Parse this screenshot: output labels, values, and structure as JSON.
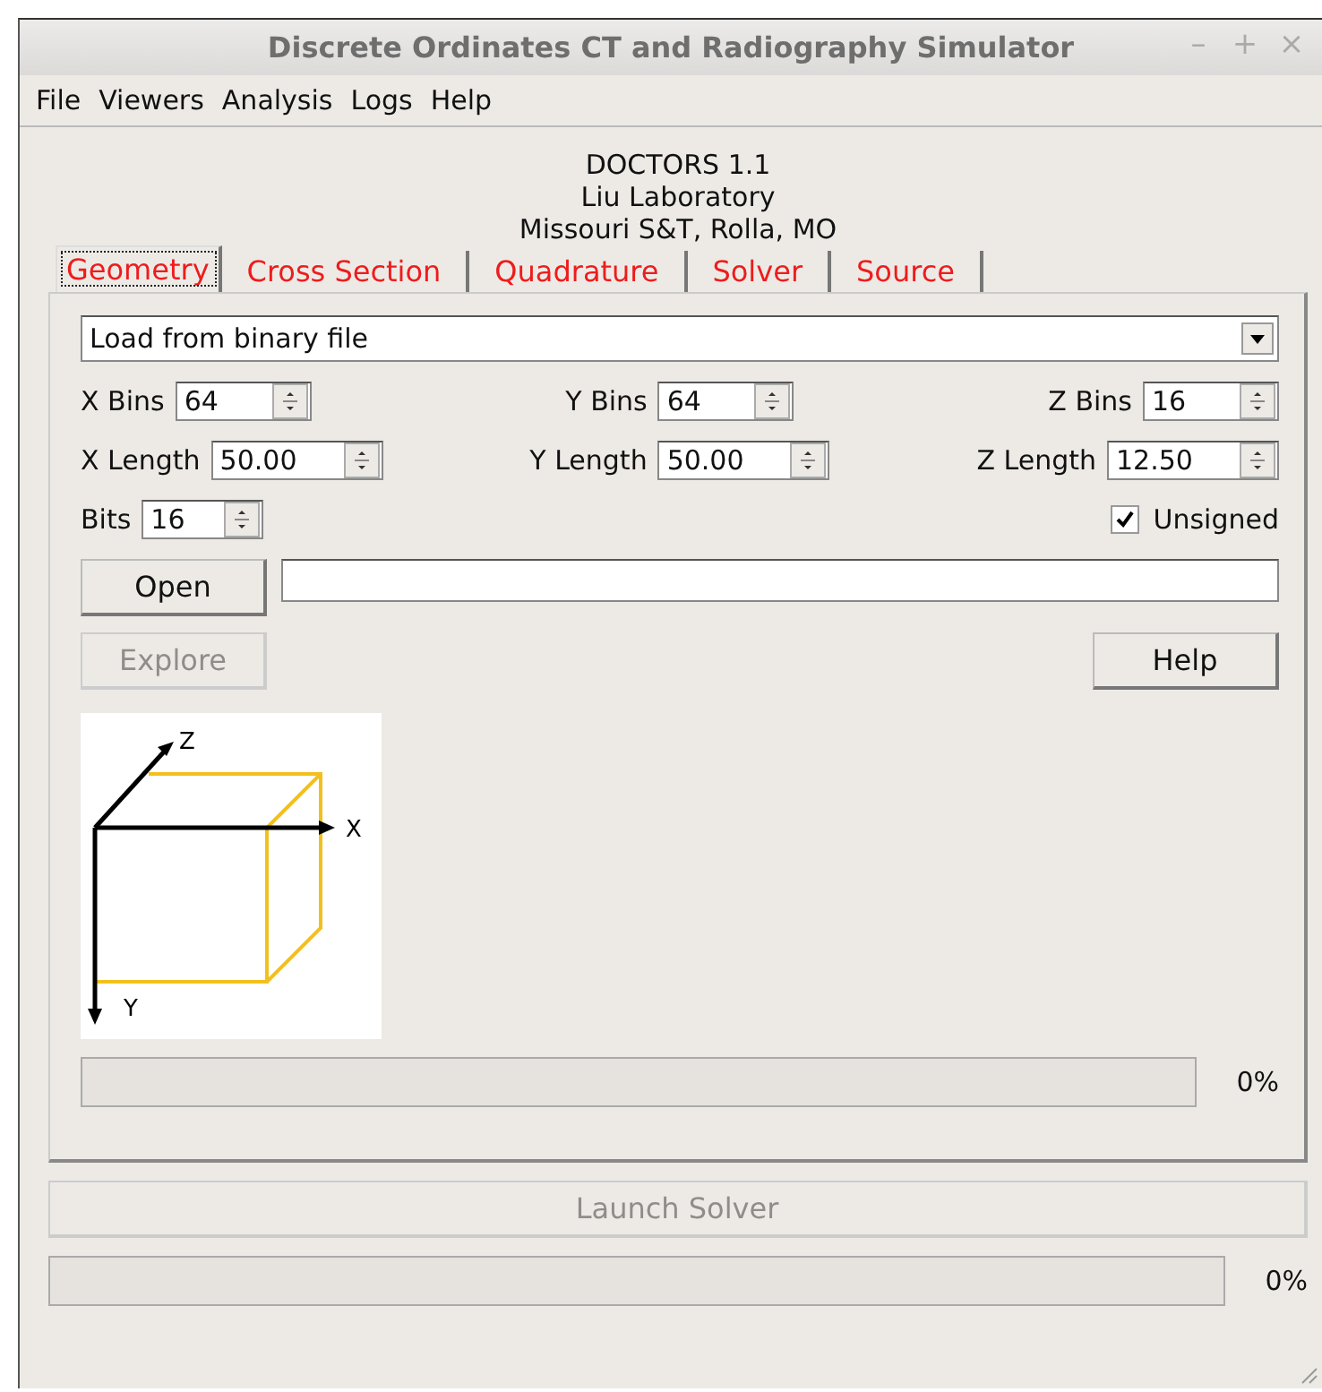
{
  "window": {
    "title": "Discrete Ordinates CT and Radiography Simulator",
    "controls": [
      "–",
      "+",
      "×"
    ]
  },
  "menu": [
    "File",
    "Viewers",
    "Analysis",
    "Logs",
    "Help"
  ],
  "header": [
    "DOCTORS 1.1",
    "Liu Laboratory",
    "Missouri S&T, Rolla, MO"
  ],
  "tabs": [
    {
      "label": "Geometry",
      "selected": true
    },
    {
      "label": "Cross Section",
      "selected": false
    },
    {
      "label": "Quadrature",
      "selected": false
    },
    {
      "label": "Solver",
      "selected": false
    },
    {
      "label": "Source",
      "selected": false
    }
  ],
  "source_dropdown": {
    "value": "Load from binary file"
  },
  "spin_rows": [
    [
      {
        "label": "X Bins",
        "value": "64"
      },
      {
        "label": "Y Bins",
        "value": "64"
      },
      {
        "label": "Z Bins",
        "value": "16"
      }
    ],
    [
      {
        "label": "X Length",
        "value": "50.00"
      },
      {
        "label": "Y Length",
        "value": "50.00"
      },
      {
        "label": "Z Length",
        "value": "12.50"
      }
    ]
  ],
  "bits": {
    "label": "Bits",
    "value": "16"
  },
  "unsigned": {
    "label": "Unsigned",
    "checked": true
  },
  "open_button": {
    "label": "Open",
    "disabled": false
  },
  "explore_button": {
    "label": "Explore",
    "disabled": true
  },
  "help_button": {
    "label": "Help",
    "disabled": false
  },
  "axes": {
    "z": "Z",
    "x": "X",
    "y": "Y"
  },
  "geometry_progress": {
    "level": 0,
    "reading": "0%"
  },
  "launch_button": {
    "label": "Launch Solver",
    "disabled": true
  },
  "solver_progress": {
    "level": 0,
    "reading": "0%"
  }
}
